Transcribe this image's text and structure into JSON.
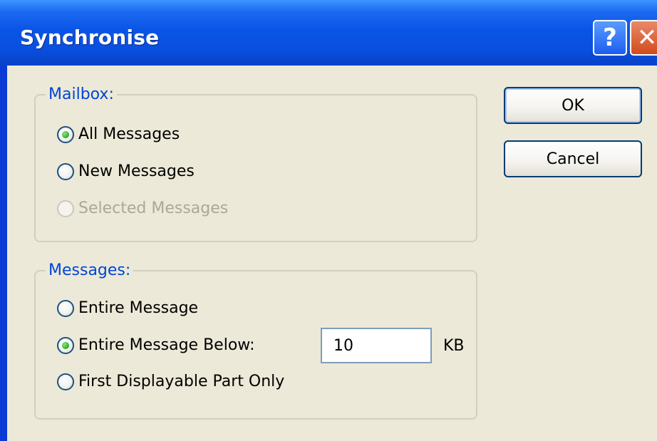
{
  "window": {
    "title": "Synchronise",
    "help_glyph": "?",
    "close_glyph": "✕"
  },
  "mailbox_group": {
    "legend": "Mailbox:",
    "options": [
      {
        "label": "All Messages",
        "checked": true,
        "enabled": true
      },
      {
        "label": "New Messages",
        "checked": false,
        "enabled": true
      },
      {
        "label": "Selected Messages",
        "checked": false,
        "enabled": false
      }
    ]
  },
  "messages_group": {
    "legend": "Messages:",
    "options": [
      {
        "label": "Entire Message",
        "checked": false,
        "enabled": true
      },
      {
        "label": "Entire Message Below:",
        "checked": true,
        "enabled": true
      },
      {
        "label": "First Displayable Part Only",
        "checked": false,
        "enabled": true
      }
    ],
    "size_value": "10",
    "size_unit": "KB"
  },
  "buttons": {
    "ok": "OK",
    "cancel": "Cancel"
  },
  "colors": {
    "title_bar": "#0a55e6",
    "dialog_face": "#ece9d8",
    "group_legend": "#0046d5",
    "radio_checked": "#3ab530",
    "disabled_text": "#aca899"
  },
  "icons": {
    "help": "help-icon",
    "close": "close-icon"
  }
}
